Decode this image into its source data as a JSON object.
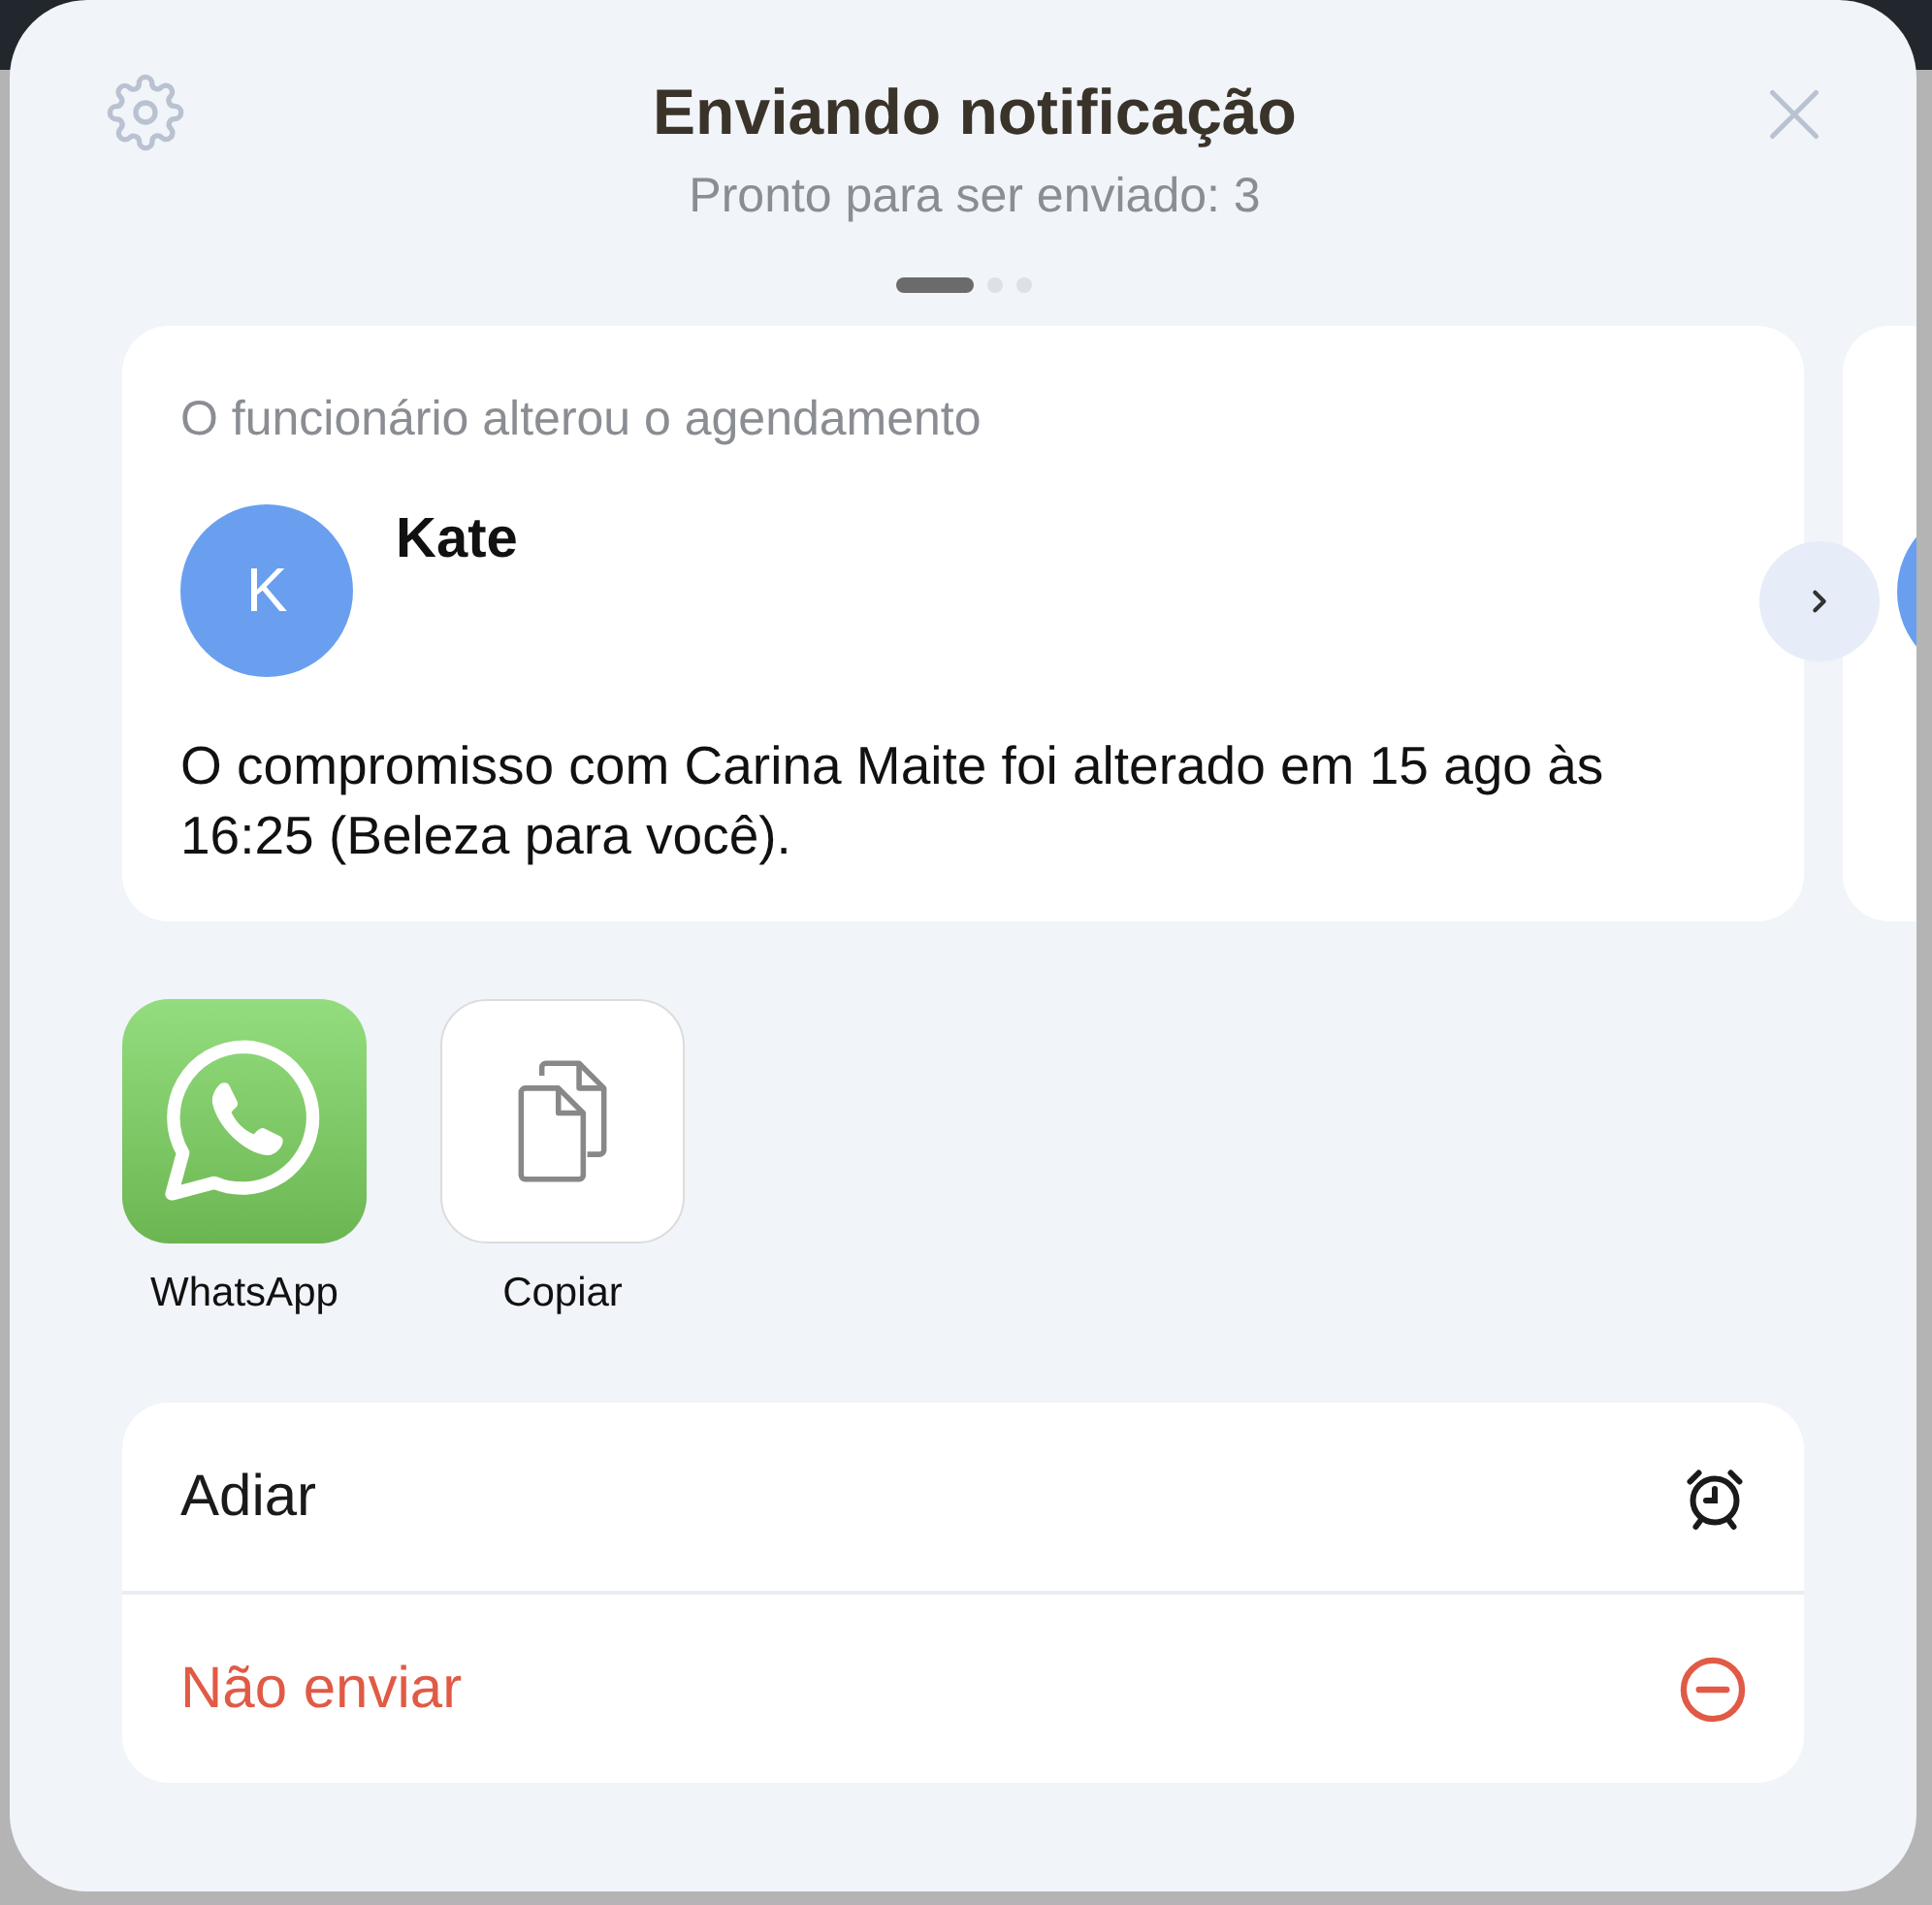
{
  "dialog": {
    "title": "Enviando notificação",
    "subtitle": "Pronto para ser enviado: 3"
  },
  "pager": [
    {
      "selected": true
    },
    {
      "selected": false
    },
    {
      "selected": false
    }
  ],
  "cards": [
    {
      "heading": "O funcionário alterou o agendamento",
      "initial": "K",
      "name": "Kate",
      "message": "O compromisso com Carina Maite foi alterado em 15 ago às 16:25 (Beleza para você)."
    }
  ],
  "share": [
    {
      "kind": "whatsapp",
      "label": "WhatsApp"
    },
    {
      "kind": "copy",
      "label": "Copiar"
    }
  ],
  "actions": [
    {
      "kind": "snooze",
      "label": "Adiar"
    },
    {
      "kind": "discard",
      "label": "Não enviar"
    }
  ]
}
